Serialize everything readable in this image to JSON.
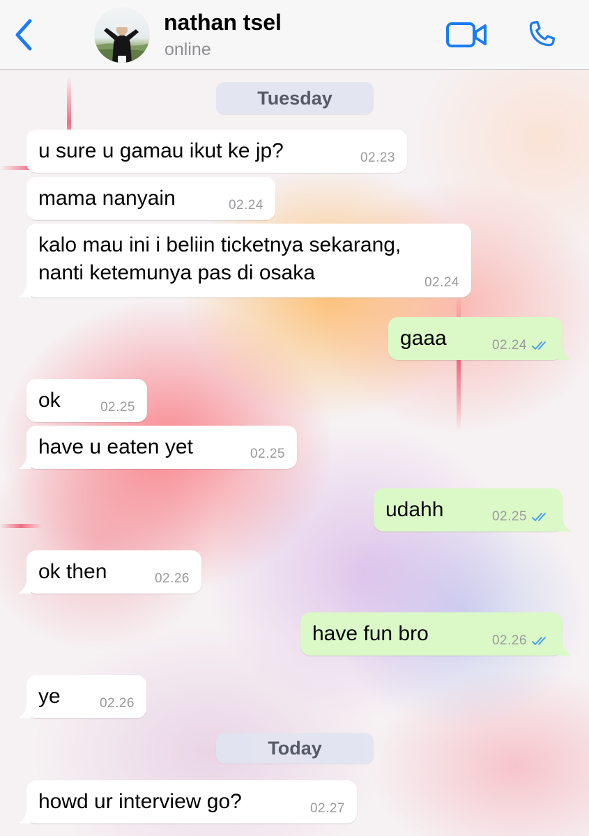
{
  "header": {
    "contact_name": "nathan tsel",
    "status": "online",
    "back_icon": "chevron-left-icon",
    "video_icon": "video-camera-icon",
    "call_icon": "phone-icon"
  },
  "colors": {
    "accent": "#1a7cf5",
    "incoming_bubble": "#ffffff",
    "outgoing_bubble": "#dbf8c7",
    "read_ticks": "#3b9bf1"
  },
  "date_separators": [
    "Tuesday",
    "Today"
  ],
  "messages": [
    {
      "direction": "in",
      "text": "u sure u gamau ikut ke jp?",
      "time": "02.23"
    },
    {
      "direction": "in",
      "text": "mama nanyain",
      "time": "02.24"
    },
    {
      "direction": "in",
      "text_line1": "kalo mau ini i beliin ticketnya sekarang,",
      "text_line2": "nanti ketemunya pas di osaka",
      "time": "02.24"
    },
    {
      "direction": "out",
      "text": "gaaa",
      "time": "02.24",
      "status": "read"
    },
    {
      "direction": "in",
      "text": "ok",
      "time": "02.25"
    },
    {
      "direction": "in",
      "text": "have u eaten yet",
      "time": "02.25"
    },
    {
      "direction": "out",
      "text": "udahh",
      "time": "02.25",
      "status": "read"
    },
    {
      "direction": "in",
      "text": "ok then",
      "time": "02.26"
    },
    {
      "direction": "out",
      "text": "have fun bro",
      "time": "02.26",
      "status": "read"
    },
    {
      "direction": "in",
      "text": "ye",
      "time": "02.26"
    },
    {
      "direction": "in",
      "text": "howd ur interview go?",
      "time": "02.27"
    }
  ]
}
